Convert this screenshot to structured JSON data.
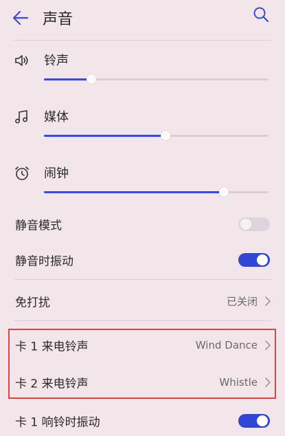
{
  "header": {
    "title": "声音",
    "back_icon": "arrow-left-icon",
    "search_icon": "search-icon"
  },
  "volumes": [
    {
      "label": "铃声",
      "icon": "speaker-icon",
      "level_pct": 21
    },
    {
      "label": "媒体",
      "icon": "music-note-icon",
      "level_pct": 54
    },
    {
      "label": "闹钟",
      "icon": "alarm-clock-icon",
      "level_pct": 80
    }
  ],
  "settings": {
    "silent_mode": {
      "label": "静音模式",
      "on": false
    },
    "vibrate_silent": {
      "label": "静音时振动",
      "on": true
    },
    "dnd": {
      "label": "免打扰",
      "value": "已关闭"
    },
    "sim1_ringtone": {
      "label": "卡 1 来电铃声",
      "value": "Wind Dance"
    },
    "sim2_ringtone": {
      "label": "卡 2 来电铃声",
      "value": "Whistle"
    },
    "sim1_vibrate": {
      "label": "卡 1 响铃时振动",
      "on": true
    }
  },
  "colors": {
    "accent": "#3046d4",
    "background": "#f2e6ea",
    "highlight_border": "#e14044"
  }
}
